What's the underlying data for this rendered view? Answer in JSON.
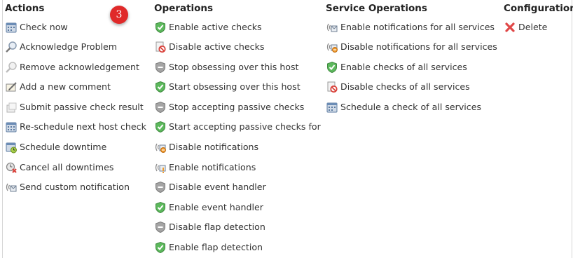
{
  "badge": {
    "count": "3"
  },
  "actions": {
    "heading": "Actions",
    "items": [
      {
        "label": "Check now",
        "icon": "calendar-check-icon"
      },
      {
        "label": "Acknowledge Problem",
        "icon": "magnifier-icon"
      },
      {
        "label": "Remove acknowledgement",
        "icon": "magnifier-disabled-icon"
      },
      {
        "label": "Add a new comment",
        "icon": "comment-pencil-icon"
      },
      {
        "label": "Submit passive check result",
        "icon": "passive-result-icon"
      },
      {
        "label": "Re-schedule next host check",
        "icon": "calendar-reschedule-icon"
      },
      {
        "label": "Schedule downtime",
        "icon": "calendar-downtime-icon"
      },
      {
        "label": "Cancel all downtimes",
        "icon": "cancel-downtime-icon"
      },
      {
        "label": "Send custom notification",
        "icon": "notification-send-icon"
      }
    ]
  },
  "operations": {
    "heading": "Operations",
    "items": [
      {
        "label": "Enable active checks",
        "icon": "shield-check-icon"
      },
      {
        "label": "Disable active checks",
        "icon": "disable-page-icon"
      },
      {
        "label": "Stop obsessing over this host",
        "icon": "shield-gray-icon"
      },
      {
        "label": "Start obsessing over this host",
        "icon": "shield-check-icon"
      },
      {
        "label": "Stop accepting passive checks",
        "icon": "shield-gray-icon"
      },
      {
        "label": "Start accepting passive checks for",
        "icon": "shield-check-icon"
      },
      {
        "label": "Disable notifications",
        "icon": "notification-disable-icon"
      },
      {
        "label": "Enable notifications",
        "icon": "notification-enable-icon"
      },
      {
        "label": "Disable event handler",
        "icon": "shield-gray-icon"
      },
      {
        "label": "Enable event handler",
        "icon": "shield-check-icon"
      },
      {
        "label": "Disable flap detection",
        "icon": "shield-gray-icon"
      },
      {
        "label": "Enable flap detection",
        "icon": "shield-check-icon"
      }
    ]
  },
  "service_operations": {
    "heading": "Service Operations",
    "items": [
      {
        "label": "Enable notifications for all services",
        "icon": "notification-send-icon"
      },
      {
        "label": "Disable notifications for all services",
        "icon": "notification-disable-icon"
      },
      {
        "label": "Enable checks of all services",
        "icon": "shield-check-icon"
      },
      {
        "label": "Disable checks of all services",
        "icon": "disable-page-icon"
      },
      {
        "label": "Schedule a check of all services",
        "icon": "calendar-check-icon"
      }
    ]
  },
  "configuration": {
    "heading": "Configuration",
    "items": [
      {
        "label": "Delete",
        "icon": "delete-x-icon"
      }
    ]
  },
  "colors": {
    "badge": "#e02a2a",
    "shield_green": "#5cb85c",
    "shield_gray": "#9a9a9a",
    "delete_red": "#e04848"
  }
}
